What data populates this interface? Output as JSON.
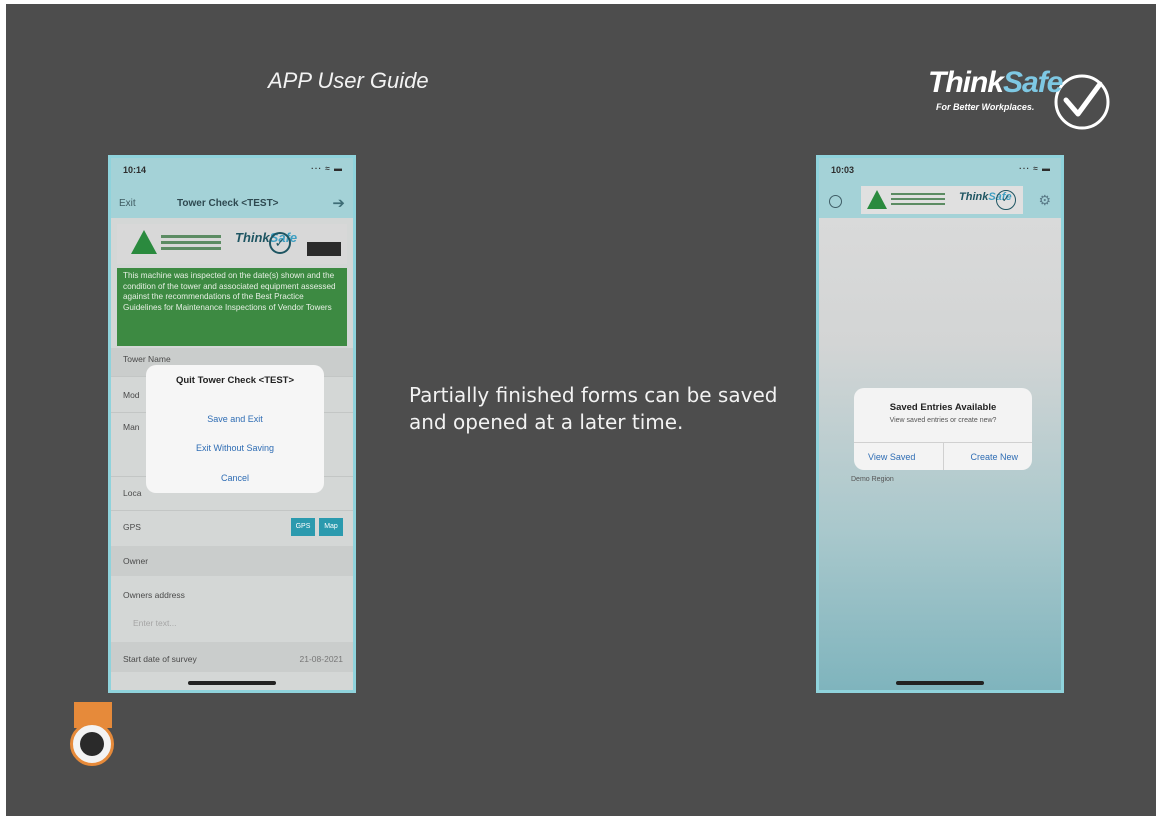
{
  "slide": {
    "title": "APP User Guide",
    "caption": "Partially finished forms can be saved and opened at a later time."
  },
  "brand": {
    "think": "Think",
    "safe": "Safe",
    "tagline": "For Better Workplaces."
  },
  "left_phone": {
    "time": "10:14",
    "signal": "··· ≈ ▬",
    "nav": {
      "exit_label": "Exit",
      "title": "Tower Check <TEST>"
    },
    "logos": {
      "think": "Think",
      "safe": "Safe",
      "badge": "",
      "check": "✓"
    },
    "info_text": "This machine was inspected on the date(s) shown and the condition of the tower and associated equipment assessed against the recommendations of the Best Practice Guidelines for Maintenance Inspections of Vendor Towers",
    "fields": {
      "tower_name": "Tower Name",
      "model": "Mod",
      "manufacturer": "Man",
      "location": "Loca",
      "gps": "GPS",
      "gps_btn1": "GPS",
      "gps_btn2": "Map",
      "owner": "Owner",
      "owners_address": "Owners address",
      "enter_text": "Enter text...",
      "start_date": "Start date of survey",
      "start_date_value": "21-08-2021"
    },
    "alert": {
      "title": "Quit Tower Check <TEST>",
      "save_exit": "Save and Exit",
      "exit_without_saving": "Exit Without Saving",
      "cancel": "Cancel"
    }
  },
  "right_phone": {
    "time": "10:03",
    "signal": "··· ≈ ▬",
    "logos": {
      "think": "Think",
      "safe": "Safe",
      "check": "✓"
    },
    "gear": "⚙",
    "alert": {
      "title": "Saved Entries Available",
      "subtitle": "View saved entries or create new?",
      "view_saved": "View Saved",
      "create_new": "Create New"
    },
    "region_text": "Demo Region"
  },
  "colors": {
    "slide_bg": "#4d4d4d",
    "phone_bar": "#a4d2d7",
    "green_box": "#3d8a42",
    "ios_blue": "#2f6db4",
    "brand_accent": "#7ec8e3"
  }
}
